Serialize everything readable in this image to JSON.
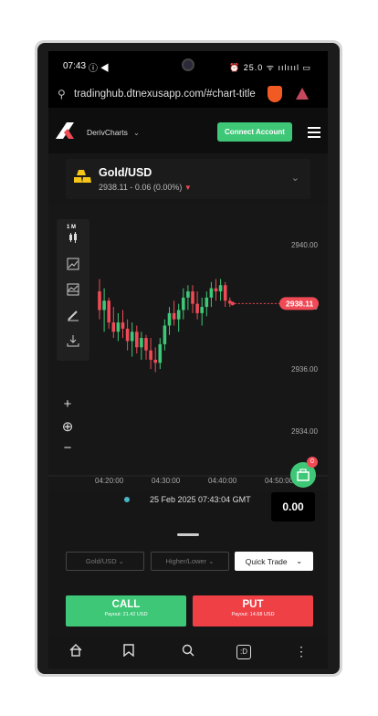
{
  "status": {
    "time": "07:43",
    "left_icons": "ⓘ ◀",
    "right_icons": "⏰ 25.0 ᯤ ıılıııl ▭"
  },
  "browser": {
    "url": "tradinghub.dtnexusapp.com/#chart-title"
  },
  "header": {
    "brand": "DerivCharts",
    "connect_label": "Connect Account"
  },
  "asset": {
    "name": "Gold/USD",
    "price_line": "2938.11 - 0.06 (0.00%)"
  },
  "toolbox": {
    "interval": "1 M"
  },
  "chart": {
    "price_labels": [
      "2940.00",
      "2938.00",
      "2936.00",
      "2934.00"
    ],
    "time_labels": [
      "04:20:00",
      "04:30:00",
      "04:40:00",
      "04:50:00"
    ],
    "current_price": "2938.11",
    "datetime": "25 Feb 2025 07:43:04 GMT",
    "colors": {
      "up": "#3ec777",
      "down": "#ef4a55"
    },
    "candles": [
      [
        2938.5,
        2938.9,
        2937.6,
        2937.9
      ],
      [
        2937.9,
        2938.6,
        2937.2,
        2938.2
      ],
      [
        2938.2,
        2938.3,
        2937.3,
        2937.5
      ],
      [
        2937.5,
        2938.0,
        2937.0,
        2937.2
      ],
      [
        2937.2,
        2937.8,
        2936.9,
        2937.5
      ],
      [
        2937.5,
        2937.9,
        2937.0,
        2937.3
      ],
      [
        2937.3,
        2937.6,
        2936.6,
        2936.9
      ],
      [
        2936.9,
        2937.5,
        2936.4,
        2937.2
      ],
      [
        2937.2,
        2937.4,
        2936.5,
        2936.7
      ],
      [
        2936.7,
        2937.2,
        2936.3,
        2937.0
      ],
      [
        2937.0,
        2937.1,
        2936.3,
        2936.6
      ],
      [
        2936.6,
        2937.0,
        2936.0,
        2936.3
      ],
      [
        2936.3,
        2936.7,
        2935.9,
        2936.2
      ],
      [
        2936.2,
        2937.0,
        2936.0,
        2936.8
      ],
      [
        2936.8,
        2937.6,
        2936.6,
        2937.4
      ],
      [
        2937.4,
        2938.0,
        2937.1,
        2937.8
      ],
      [
        2937.8,
        2938.2,
        2937.4,
        2937.6
      ],
      [
        2937.6,
        2938.1,
        2937.2,
        2937.9
      ],
      [
        2937.9,
        2938.6,
        2937.6,
        2938.3
      ],
      [
        2938.3,
        2938.7,
        2937.9,
        2938.5
      ],
      [
        2938.5,
        2938.7,
        2937.8,
        2938.1
      ],
      [
        2938.1,
        2938.5,
        2937.6,
        2937.8
      ],
      [
        2937.8,
        2938.3,
        2937.4,
        2938.0
      ],
      [
        2938.0,
        2938.5,
        2937.7,
        2938.3
      ],
      [
        2938.3,
        2938.8,
        2938.0,
        2938.6
      ],
      [
        2938.6,
        2938.9,
        2938.2,
        2938.5
      ],
      [
        2938.5,
        2938.9,
        2938.2,
        2938.7
      ],
      [
        2938.7,
        2938.8,
        2938.0,
        2938.2
      ],
      [
        2938.2,
        2938.3,
        2938.0,
        2938.11
      ]
    ]
  },
  "balance": "0.00",
  "portfolio_badge": "0",
  "trade": {
    "selectors": [
      "Gold/USD",
      "Higher/Lower",
      "Quick Trade"
    ],
    "call": {
      "label": "CALL",
      "payout": "Payout: 21.42 USD"
    },
    "put": {
      "label": "PUT",
      "payout": "Payout: 14.68 USD"
    }
  },
  "navbar": {
    "tabs_label": ":D"
  }
}
